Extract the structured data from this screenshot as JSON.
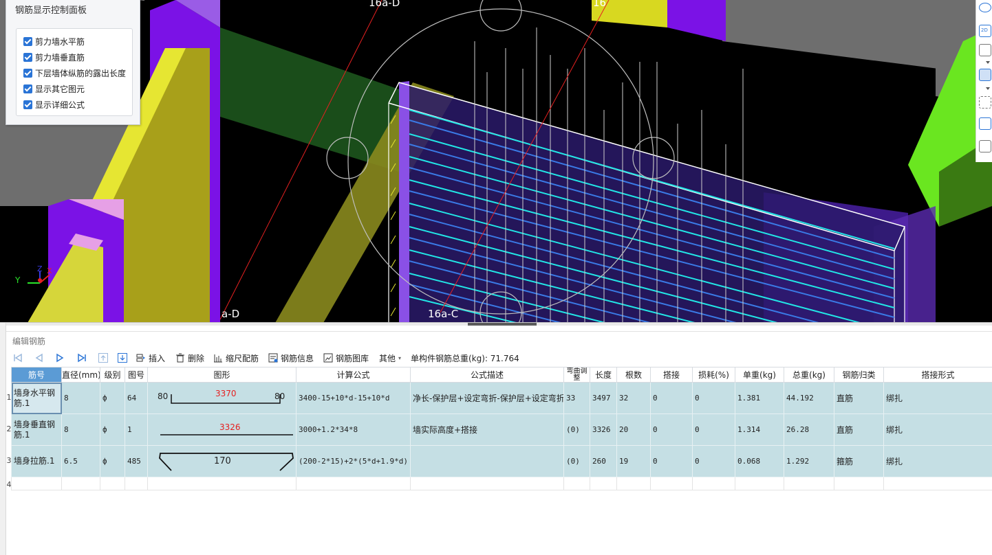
{
  "viewport": {
    "grid_labels": [
      "16a-D",
      "16",
      "a-D",
      "16a-C"
    ],
    "axis": {
      "x": "X",
      "y": "Y",
      "z": "Z"
    }
  },
  "control_panel": {
    "title": "钢筋显示控制面板",
    "options": [
      {
        "label": "剪力墙水平筋",
        "checked": true
      },
      {
        "label": "剪力墙垂直筋",
        "checked": true
      },
      {
        "label": "下层墙体纵筋的露出长度",
        "checked": true
      },
      {
        "label": "显示其它图元",
        "checked": true
      },
      {
        "label": "显示详细公式",
        "checked": true
      }
    ]
  },
  "right_toolbar": {
    "icons": [
      "ellipse-icon",
      "2d-icon",
      "box-view-icon",
      "box-solid-icon",
      "dashed-select-icon",
      "cube-icon",
      "list-settings-icon"
    ],
    "badge_2d": "2D"
  },
  "editor": {
    "title": "编辑钢筋",
    "toolbar": {
      "insert": "插入",
      "delete": "删除",
      "scale": "缩尺配筋",
      "info": "钢筋信息",
      "library": "钢筋图库",
      "other": "其他",
      "total_label": "单构件钢筋总重(kg): 71.764"
    },
    "columns": [
      "筋号",
      "直径(mm)",
      "级别",
      "图号",
      "图形",
      "计算公式",
      "公式描述",
      "弯曲调整",
      "长度",
      "根数",
      "搭接",
      "损耗(%)",
      "单重(kg)",
      "总重(kg)",
      "钢筋归类",
      "搭接形式"
    ],
    "rows": [
      {
        "num": "1",
        "name": "墙身水平钢筋.1",
        "dia": "8",
        "grade": "ф",
        "fig": "64",
        "shape": {
          "left": "80",
          "mid": "3370",
          "right": "80"
        },
        "formula": "3400-15+10*d-15+10*d",
        "desc": "净长-保护层+设定弯折-保护层+设定弯折",
        "bend": "33",
        "length": "3497",
        "count": "32",
        "lap": "0",
        "loss": "0",
        "unit_w": "1.381",
        "total_w": "44.192",
        "cat": "直筋",
        "lap_type": "绑扎"
      },
      {
        "num": "2",
        "name": "墙身垂直钢筋.1",
        "dia": "8",
        "grade": "ф",
        "fig": "1",
        "shape": {
          "left": "",
          "mid": "3326",
          "right": ""
        },
        "formula": "3000+1.2*34*8",
        "desc": "墙实际高度+搭接",
        "bend": "(0)",
        "length": "3326",
        "count": "20",
        "lap": "0",
        "loss": "0",
        "unit_w": "1.314",
        "total_w": "26.28",
        "cat": "直筋",
        "lap_type": "绑扎"
      },
      {
        "num": "3",
        "name": "墙身拉筋.1",
        "dia": "6.5",
        "grade": "ф",
        "fig": "485",
        "shape": {
          "left": "",
          "mid": "170",
          "right": ""
        },
        "formula": "(200-2*15)+2*(5*d+1.9*d)",
        "desc": "",
        "bend": "(0)",
        "length": "260",
        "count": "19",
        "lap": "0",
        "loss": "0",
        "unit_w": "0.068",
        "total_w": "1.292",
        "cat": "箍筋",
        "lap_type": "绑扎"
      }
    ],
    "empty_row_num": "4"
  }
}
